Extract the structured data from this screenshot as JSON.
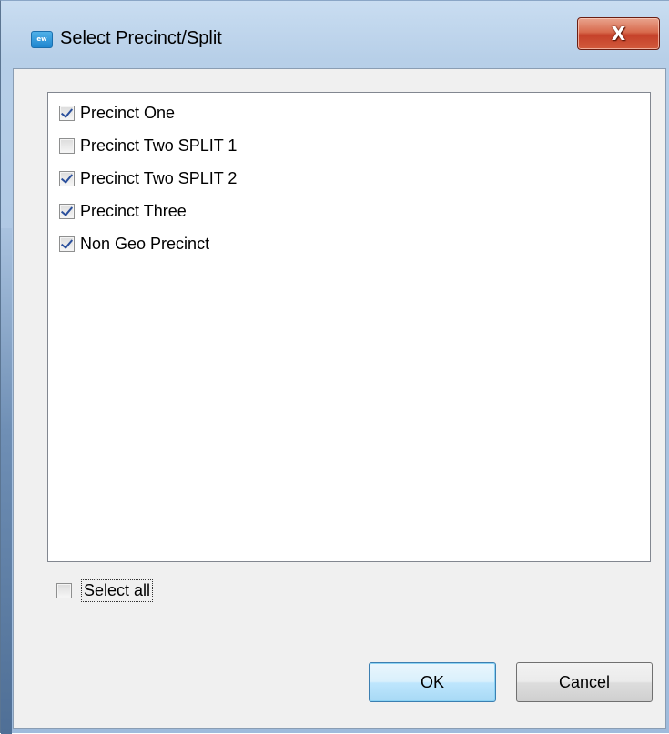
{
  "window": {
    "title": "Select Precinct/Split",
    "icon_text": "ew",
    "icon_name": "app-icon",
    "close_label": "X"
  },
  "list": {
    "items": [
      {
        "label": "Precinct One",
        "checked": true
      },
      {
        "label": "Precinct Two SPLIT 1",
        "checked": false
      },
      {
        "label": "Precinct Two SPLIT 2",
        "checked": true
      },
      {
        "label": "Precinct Three",
        "checked": true
      },
      {
        "label": "Non Geo Precinct",
        "checked": true
      }
    ]
  },
  "select_all": {
    "label": "Select all",
    "checked": false
  },
  "buttons": {
    "ok_label": "OK",
    "cancel_label": "Cancel"
  },
  "colors": {
    "frame": "#adc6e3",
    "close_button": "#c5412a",
    "checkmark": "#2a4f9c",
    "ok_button_border": "#3c7fb1"
  }
}
